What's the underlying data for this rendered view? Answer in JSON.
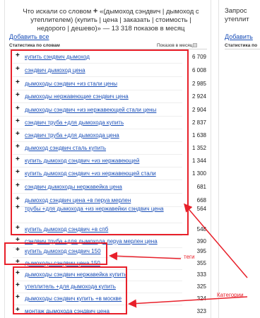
{
  "header": {
    "line1_pre": "Что искали со словом",
    "plus": "+",
    "line1_post": "«(дымоход сэндвич | дымоход с",
    "line2": "утеплителем) (купить | цена | заказать | стоимость |",
    "line3": "недорого | дешево)» — 13 318 показов в месяц"
  },
  "add_all_label": "Добавить все",
  "columns": {
    "query": "Статистика по словам",
    "impressions": "Показов в месяц"
  },
  "rows": [
    {
      "text": "купить сэндвич дымоход",
      "count": "6 709"
    },
    {
      "text": "сэндвич дымоход цена",
      "count": "6 008"
    },
    {
      "text": "дымоходы сэндвич +из стали цены",
      "count": "2 985"
    },
    {
      "text": "дымоходы нержавеющие сэндвич цена",
      "count": "2 924"
    },
    {
      "text": "дымоходы сэндвич +из нержавеющей стали цены",
      "count": "2 904"
    },
    {
      "text": "сэндвич труба +для дымохода купить",
      "count": "2 837"
    },
    {
      "text": "сэндвич труба +для дымохода цена",
      "count": "1 638"
    },
    {
      "text": "дымоход сэндвич сталь купить",
      "count": "1 352"
    },
    {
      "text": "купить дымоход сэндвич +из нержавеющей",
      "count": "1 344"
    },
    {
      "text": "купить дымоход сэндвич +из нержавеющей стали",
      "count": "1 300"
    },
    {
      "text": "сэндвич дымоходы нержавейка цена",
      "count": "681"
    },
    {
      "text": "дымоход сэндвич цена +в перуа мерлен",
      "count": "668"
    },
    {
      "text": "трубы +для дымохода +из нержавейки сэндвич цена",
      "count": "564"
    },
    {
      "text": "купить дымоход сэндвич +в спб",
      "count": "548"
    },
    {
      "text": "сэндвич труба +для дымохода леруа мерлен цена",
      "count": "390"
    },
    {
      "text": "купить дымоход сэндвич 150",
      "count": "395"
    },
    {
      "text": "дымоходы сэндвич цена 150",
      "count": "355"
    },
    {
      "text": "дымоходы сэндвич нержавейка купить",
      "count": "333"
    },
    {
      "text": "утеплитель +для дымохода купить",
      "count": "325"
    },
    {
      "text": "дымоходы сэндвич купить +в москве",
      "count": "324"
    },
    {
      "text": "монтаж дымохода сэндвич цена",
      "count": "323"
    }
  ],
  "annotations": {
    "tags": "теги",
    "categories": "Категории"
  },
  "right_panel": {
    "line1": "Запрос",
    "line2": "утеплит",
    "add_all_label": "Добавить",
    "column": "Статистика по"
  },
  "colors": {
    "link": "#1a4fb8",
    "annotation": "#e8202a"
  }
}
